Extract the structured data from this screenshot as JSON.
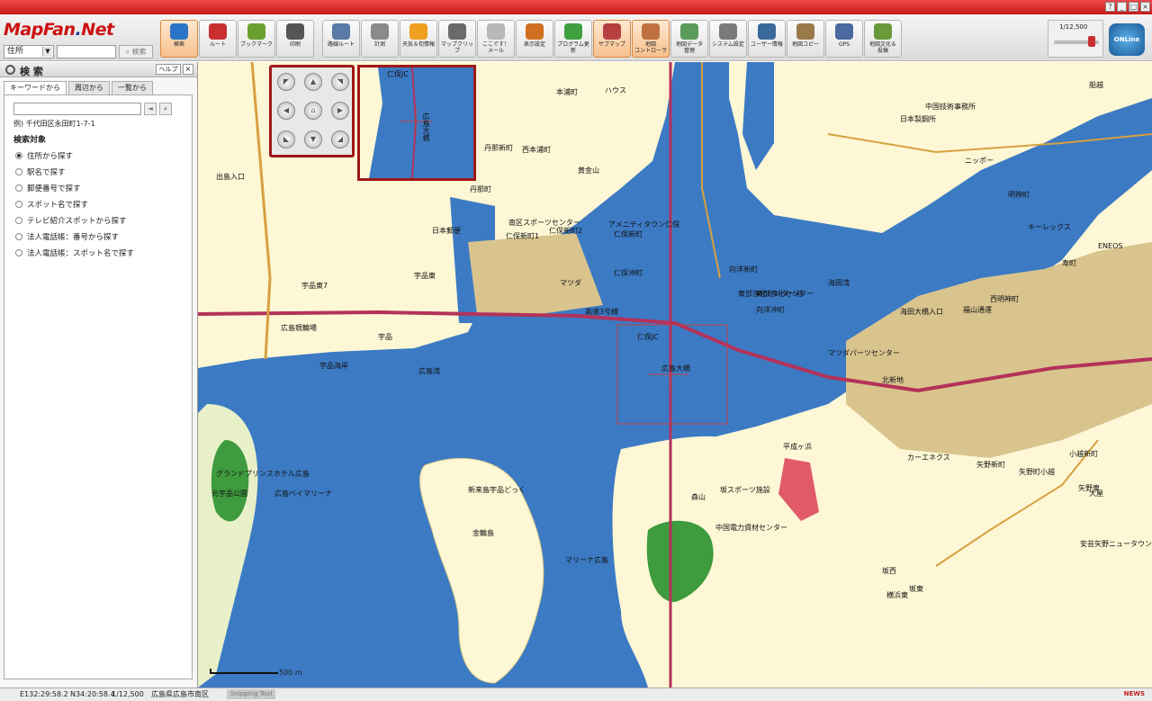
{
  "app": {
    "logo_main": "MapFan",
    "logo_dot": ".",
    "logo_net": "Net",
    "window_controls": [
      "?",
      "_",
      "□",
      "×"
    ]
  },
  "search": {
    "type_select": "住所",
    "query": "",
    "search_label": "検索"
  },
  "toolbar": {
    "group1": [
      {
        "label": "検索",
        "icon": "search-icon",
        "color": "#2a74c8",
        "active": true
      },
      {
        "label": "ルート",
        "icon": "car-icon",
        "color": "#c83030",
        "active": false
      },
      {
        "label": "ブックマーク",
        "icon": "bookmark-icon",
        "color": "#6aa030",
        "active": false
      },
      {
        "label": "印刷",
        "icon": "printer-icon",
        "color": "#555555",
        "active": false
      }
    ],
    "group2": [
      {
        "label": "路線ルート",
        "icon": "train-icon",
        "color": "#5a7aa8",
        "active": false
      },
      {
        "label": "計測",
        "icon": "ruler-icon",
        "color": "#8a8a8a",
        "active": false
      },
      {
        "label": "天気＆旬情報",
        "icon": "sun-icon",
        "color": "#f0a020",
        "active": false
      },
      {
        "label": "マップクリップ",
        "icon": "clip-icon",
        "color": "#6a6a6a",
        "active": false
      },
      {
        "label": "ここです！\nメール",
        "icon": "mail-icon",
        "color": "#b8b8b8",
        "active": false
      },
      {
        "label": "表示設定",
        "icon": "display-settings-icon",
        "color": "#d07020",
        "active": false
      },
      {
        "label": "プログラム更新",
        "icon": "update-icon",
        "color": "#40a040",
        "active": false
      },
      {
        "label": "サブマップ",
        "icon": "submap-icon",
        "color": "#b84040",
        "active": true
      },
      {
        "label": "地図\nコントローラ",
        "icon": "controller-icon",
        "color": "#c07040",
        "active": true
      },
      {
        "label": "地図データ\n管理",
        "icon": "data-icon",
        "color": "#5a9a5a",
        "active": false
      },
      {
        "label": "システム設定",
        "icon": "gear-icon",
        "color": "#7a7a7a",
        "active": false
      },
      {
        "label": "ユーザー情報",
        "icon": "user-icon",
        "color": "#3a6a9a",
        "active": false
      },
      {
        "label": "地図コピー",
        "icon": "copy-icon",
        "color": "#9a7a4a",
        "active": false
      },
      {
        "label": "GPS",
        "icon": "gps-icon",
        "color": "#4a6aa0",
        "active": false
      },
      {
        "label": "地図文化＆\n投稿",
        "icon": "post-icon",
        "color": "#6a9a3a",
        "active": false
      }
    ],
    "scale": "1/12,500",
    "online_label": "ONLine"
  },
  "panel": {
    "title": "検 索",
    "help": "ヘルプ",
    "close": "×",
    "tabs": [
      {
        "label": "キーワードから",
        "active": true
      },
      {
        "label": "周辺から",
        "active": false
      },
      {
        "label": "一覧から",
        "active": false
      }
    ],
    "example": "例) 千代田区永田町1-7-1",
    "target_label": "検索対象",
    "options": [
      {
        "label": "住所から探す",
        "selected": true
      },
      {
        "label": "駅名で探す",
        "selected": false
      },
      {
        "label": "郵便番号で探す",
        "selected": false
      },
      {
        "label": "スポット名で探す",
        "selected": false
      },
      {
        "label": "テレビ紹介スポットから探す",
        "selected": false
      },
      {
        "label": "法人電話帳：番号から探す",
        "selected": false
      },
      {
        "label": "法人電話帳：スポット名で探す",
        "selected": false
      }
    ]
  },
  "map": {
    "labels": [
      "仁保JC",
      "広島大橋",
      "広島湾",
      "宇品",
      "海田湾",
      "海田大橋入口",
      "ENEOS",
      "マツダ",
      "仁保沖町",
      "向洋新町",
      "黄金山",
      "丹那町",
      "東部浄化センター",
      "向洋沖町",
      "福山通運",
      "西明神町",
      "船越",
      "ハウス",
      "本浦町",
      "西本浦町",
      "丹那新町",
      "仁保新町",
      "南区スポーツセンター",
      "アメニティタウン仁保",
      "マリーナ広島",
      "金輪島",
      "森山",
      "坂スポーツ施設",
      "横浜東",
      "中国電力資材センター",
      "平成ヶ浜",
      "矢野新町",
      "矢野町小越",
      "矢野東",
      "大屋",
      "明神町",
      "寿町",
      "日本製鋼所",
      "キーレックス",
      "カーエネクス",
      "元宇品公園",
      "広島ベイマリーナ",
      "グランドプリンスホテル広島",
      "宇品海岸",
      "出島入口",
      "新来島宇品どっく",
      "高速3号線",
      "北新地",
      "小越新町",
      "安芸矢野ニュータウン",
      "坂東",
      "坂西",
      "中国技術事務所",
      "ニッポー",
      "マツダパーツセンター",
      "日本郵便",
      "広島競輪場",
      "宇品東",
      "宇品東7",
      "仁保新町1",
      "仁保新町2",
      "東部浄化センター前"
    ],
    "scale_label": "500 m",
    "minimap_labels": [
      "仁保JC",
      "広島大橋"
    ]
  },
  "status": {
    "coords_e": "E132:29:58.2",
    "coords_n": "N34:20:58.4",
    "scale": "1/12,500",
    "address": "広島県広島市南区",
    "snipping": "Snipping Tool",
    "news": "NEWS"
  },
  "colors": {
    "brand": "#cc1010",
    "water": "#3c7ac4",
    "land": "#fdf7d5",
    "park": "#3e9b3e",
    "highway": "#b4325a"
  }
}
